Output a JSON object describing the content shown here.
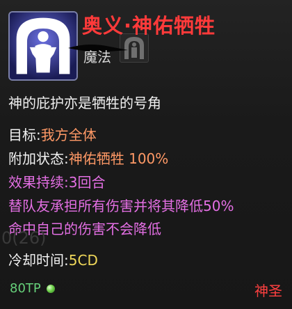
{
  "skill": {
    "name": "奥义·神佑牺牲",
    "category": "魔法",
    "description": "神的庇护亦是牺牲的号角",
    "icon": "sacrifice-figure-icon",
    "target_label": "目标:",
    "target_value": "我方全体",
    "status_label": "附加状态:",
    "status_value": "神佑牺牲 100%",
    "duration_label": "效果持续:",
    "duration_value": "3回合",
    "effect_line1": "替队友承担所有伤害并将其降低50%",
    "effect_line2": "命中自己的伤害不会降低",
    "faint_text": "0(26)",
    "cooldown_label": "冷却时间:",
    "cooldown_value": "5CD",
    "tp_cost": "80TP",
    "school": "神圣"
  },
  "colors": {
    "title": "#ff3a3a",
    "orange": "#ff9966",
    "pink": "#e46fe4",
    "yellow": "#f0d85a",
    "tp": "#66d07a",
    "school": "#ff4040"
  }
}
